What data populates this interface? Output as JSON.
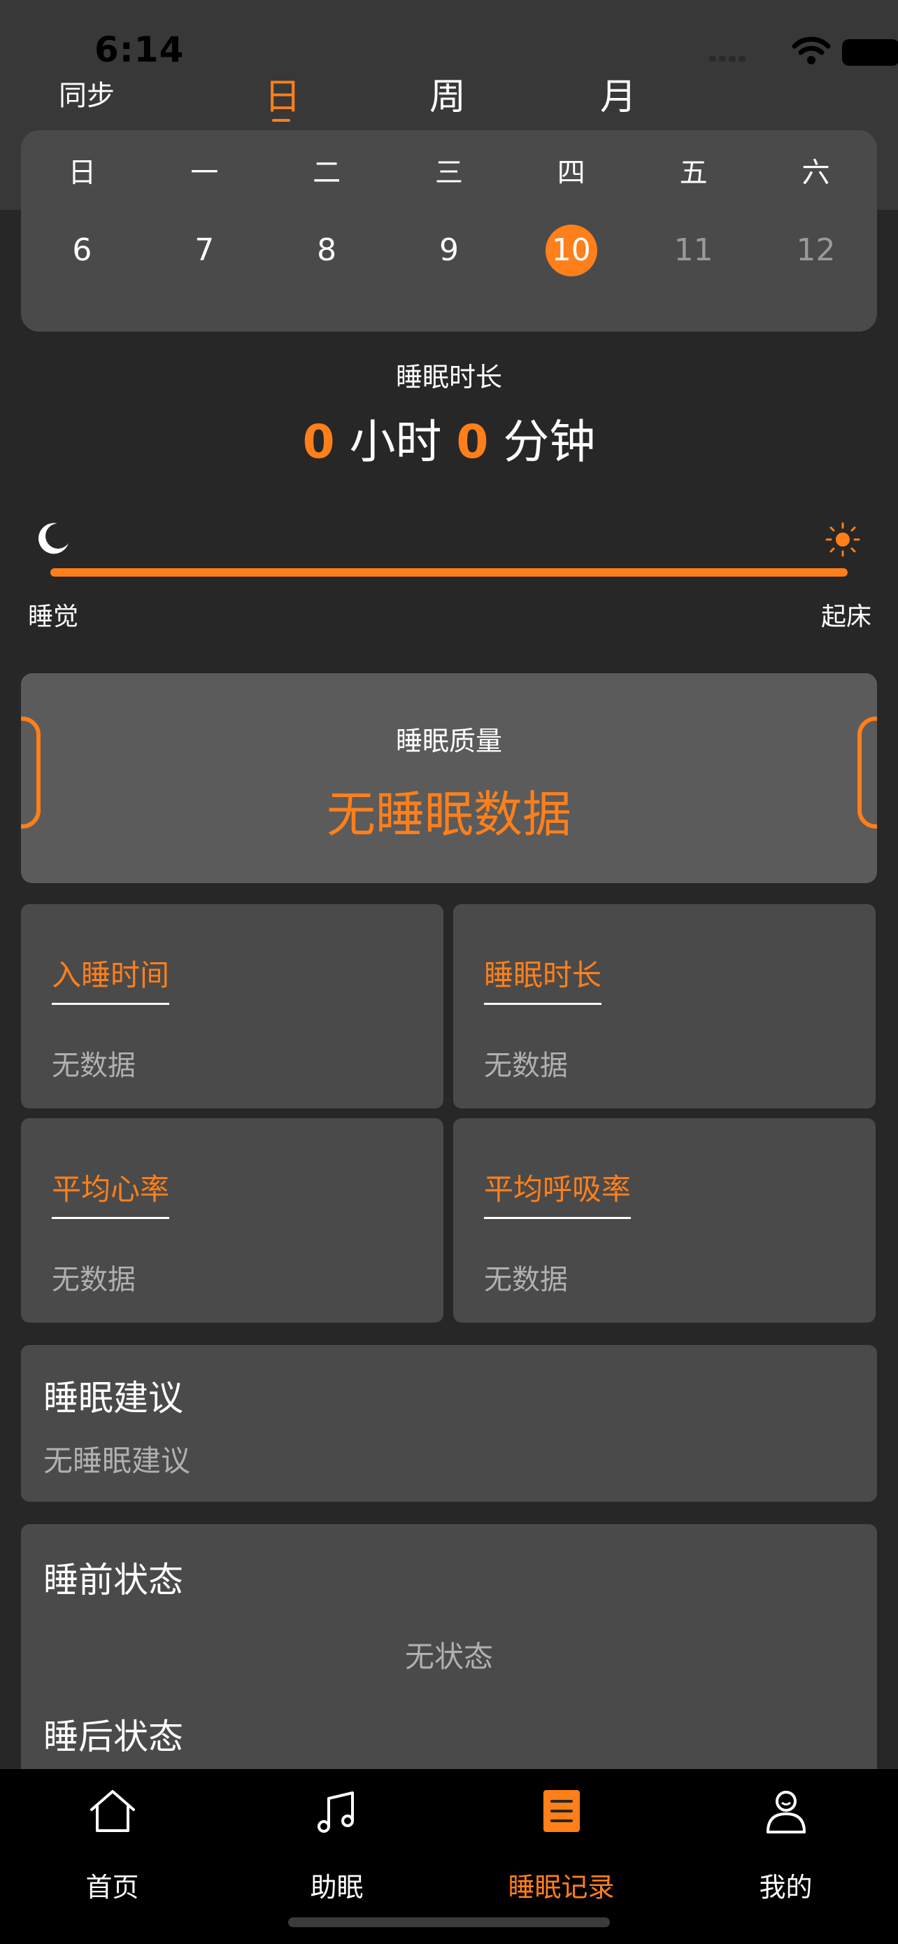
{
  "status_bar": {
    "time": "6:14"
  },
  "header": {
    "sync_label": "同步",
    "tabs": [
      {
        "label": "日",
        "active": true
      },
      {
        "label": "周",
        "active": false
      },
      {
        "label": "月",
        "active": false
      }
    ]
  },
  "calendar": {
    "weekdays": [
      "日",
      "一",
      "二",
      "三",
      "四",
      "五",
      "六"
    ],
    "days": [
      {
        "label": "6",
        "state": "normal"
      },
      {
        "label": "7",
        "state": "normal"
      },
      {
        "label": "8",
        "state": "normal"
      },
      {
        "label": "9",
        "state": "normal"
      },
      {
        "label": "10",
        "state": "selected"
      },
      {
        "label": "11",
        "state": "future"
      },
      {
        "label": "12",
        "state": "future"
      }
    ]
  },
  "duration": {
    "label": "睡眠时长",
    "hours": "0",
    "hours_unit": "小时",
    "minutes": "0",
    "minutes_unit": "分钟"
  },
  "timeline": {
    "sleep_label": "睡觉",
    "wake_label": "起床"
  },
  "quality": {
    "title": "睡眠质量",
    "value": "无睡眠数据"
  },
  "metrics": [
    {
      "title": "入睡时间",
      "value": "无数据"
    },
    {
      "title": "睡眠时长",
      "value": "无数据"
    },
    {
      "title": "平均心率",
      "value": "无数据"
    },
    {
      "title": "平均呼吸率",
      "value": "无数据"
    }
  ],
  "advice": {
    "title": "睡眠建议",
    "value": "无睡眠建议"
  },
  "state": {
    "pre_title": "睡前状态",
    "none_label": "无状态",
    "post_title": "睡后状态"
  },
  "tabbar": {
    "items": [
      {
        "label": "首页",
        "icon": "home-icon",
        "active": false
      },
      {
        "label": "助眠",
        "icon": "music-note-icon",
        "active": false
      },
      {
        "label": "睡眠记录",
        "icon": "record-list-icon",
        "active": true
      },
      {
        "label": "我的",
        "icon": "profile-icon",
        "active": false
      }
    ]
  },
  "colors": {
    "accent": "#ff7f1a",
    "background": "#272727",
    "card": "#4a4a4a"
  }
}
